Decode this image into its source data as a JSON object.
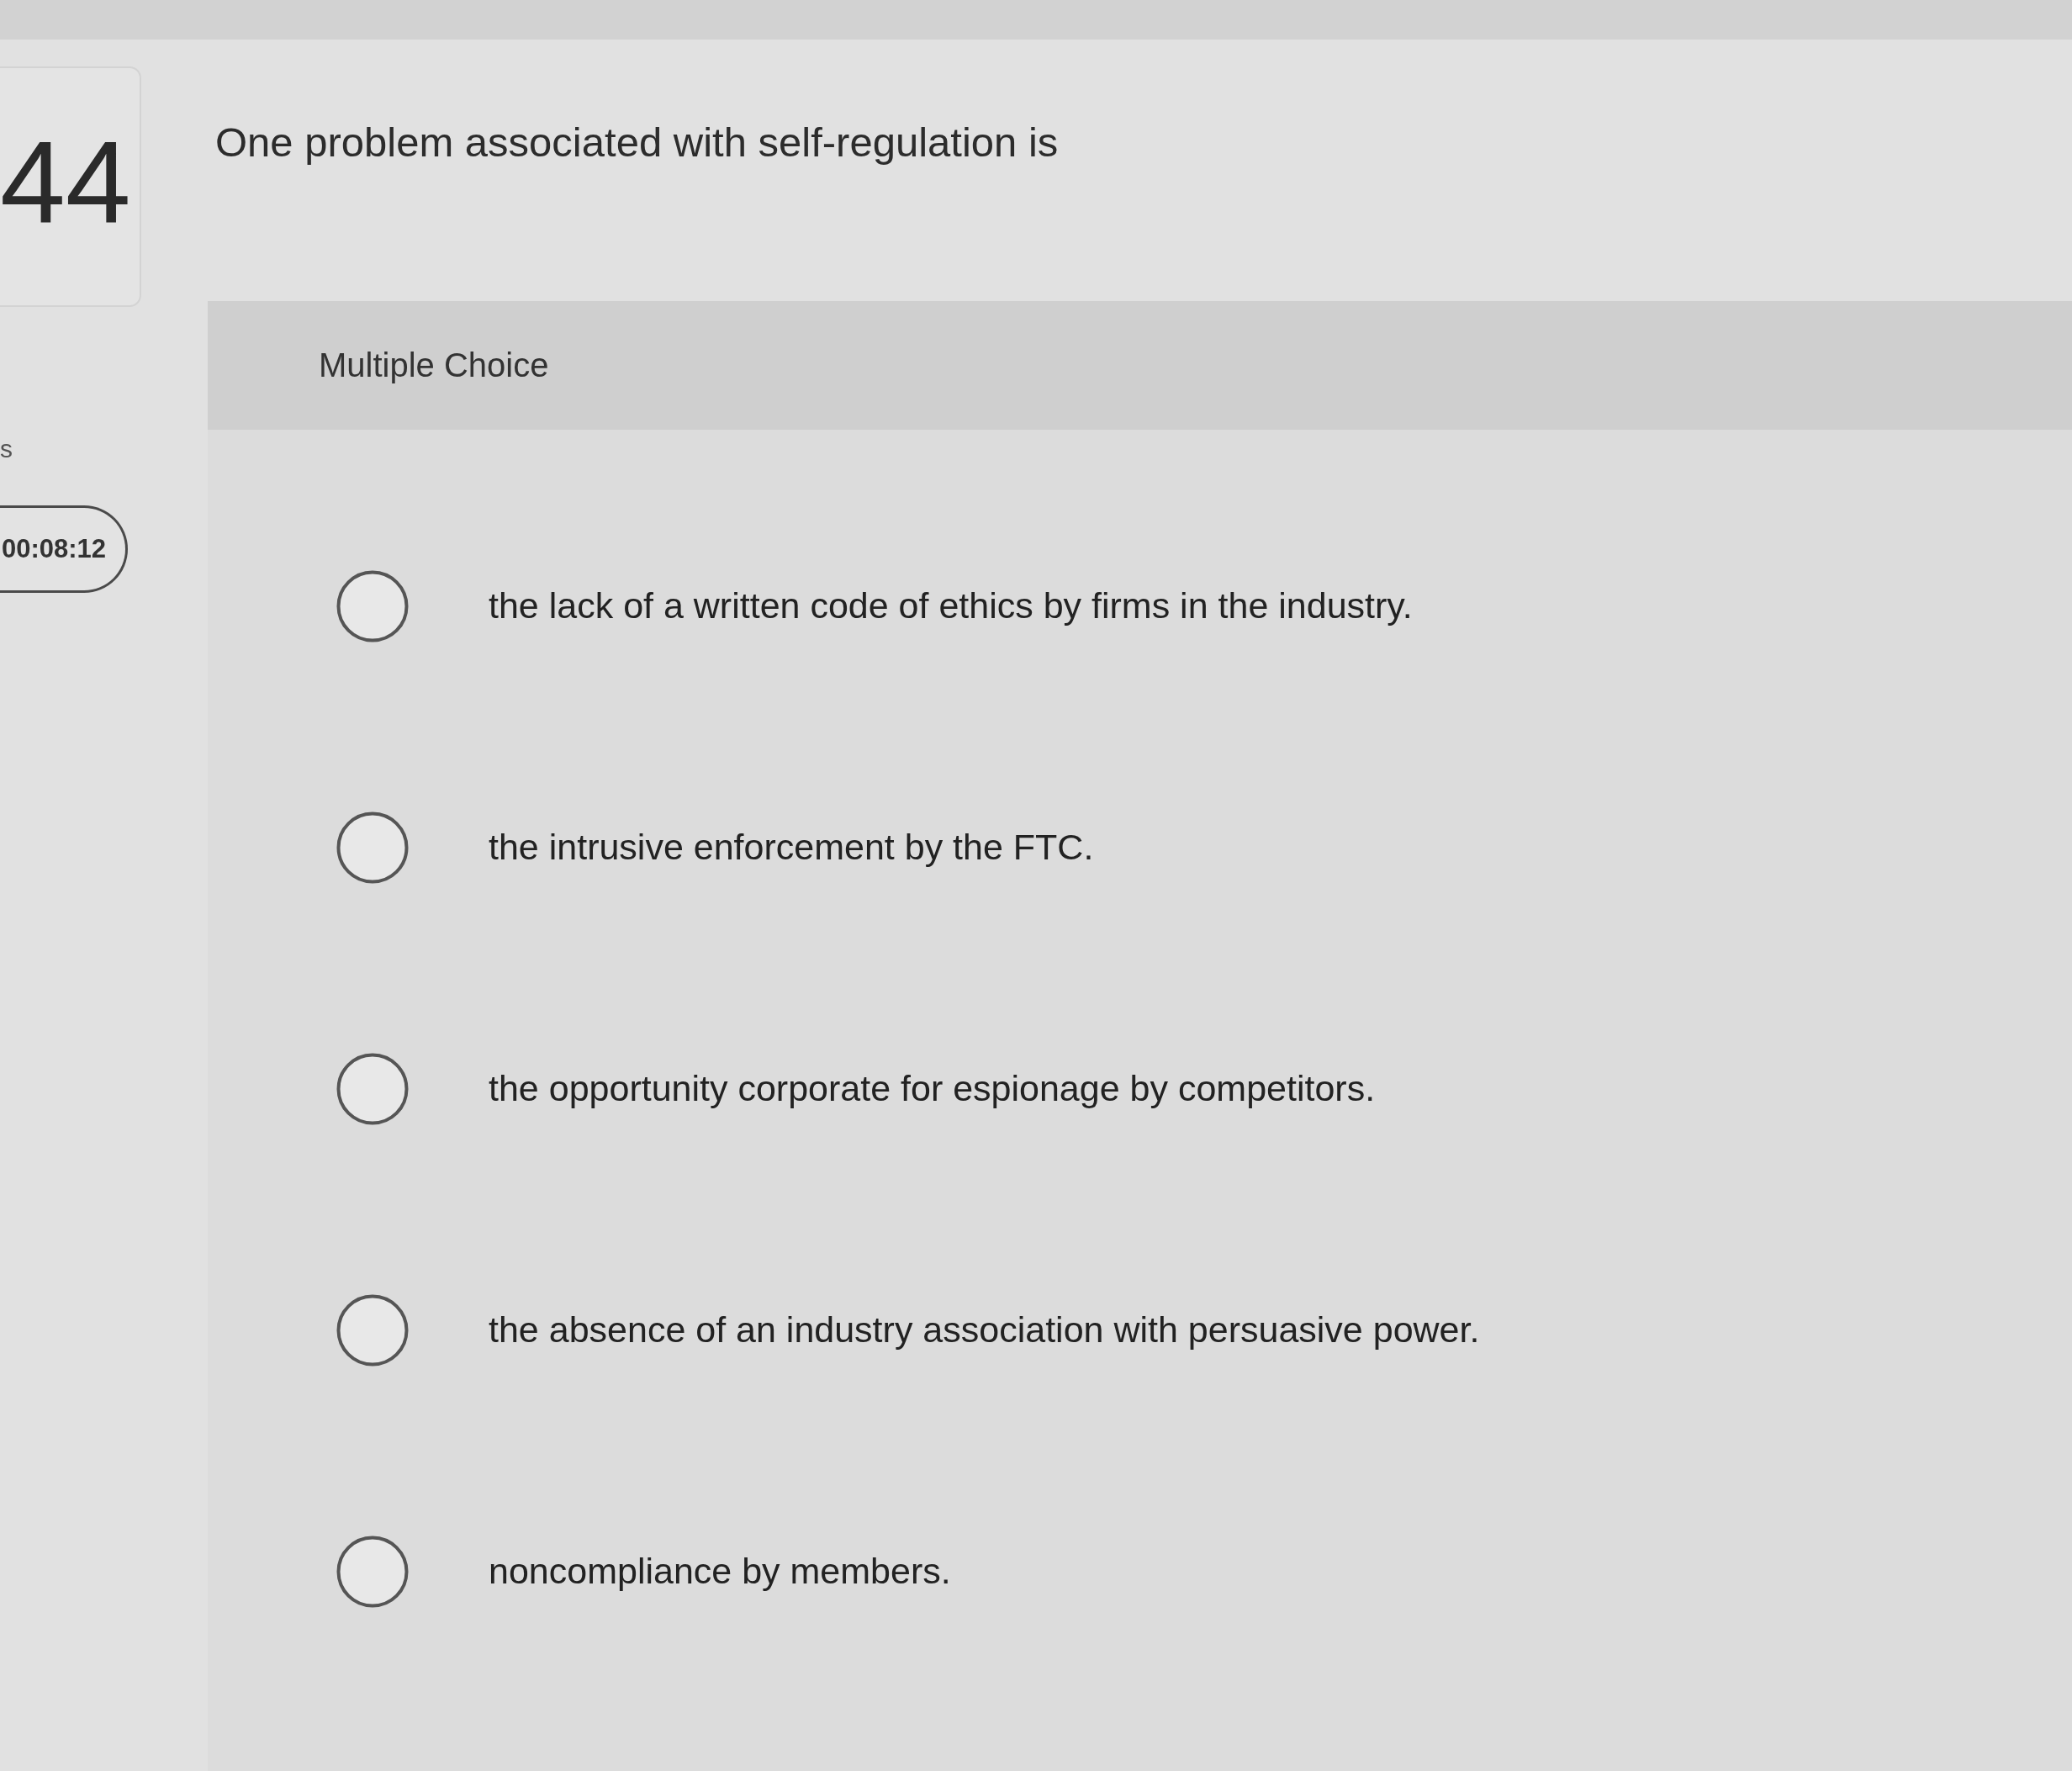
{
  "question_number": {
    "number": "44"
  },
  "sidebar": {
    "label": "s",
    "timer": "00:08:12"
  },
  "question": {
    "text": "One problem associated with self-regulation is"
  },
  "answer_panel": {
    "type_label": "Multiple Choice",
    "options": [
      {
        "text": "the lack of a written code of ethics by firms in the industry.",
        "selected": false
      },
      {
        "text": "the intrusive enforcement by the FTC.",
        "selected": false
      },
      {
        "text": "the opportunity corporate for espionage by competitors.",
        "selected": false
      },
      {
        "text": "the absence of an industry association with persuasive power.",
        "selected": false
      },
      {
        "text": "noncompliance by members.",
        "selected": false
      }
    ]
  }
}
